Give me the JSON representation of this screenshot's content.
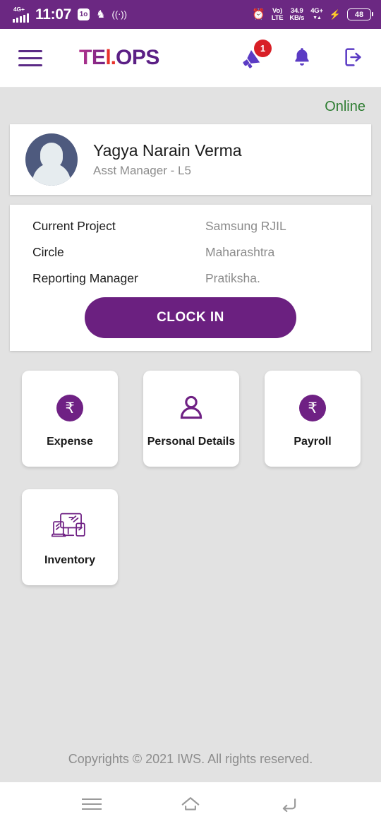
{
  "status_bar": {
    "network_tag": "4G+",
    "signal_icon": "signal-bars-icon",
    "time": "11:07",
    "data_saver_label": "1o",
    "usb_icon": "usb-icon",
    "cast_icon": "cast-icon",
    "alarm_icon": "alarm-clock-icon",
    "volte_line1": "Vo)",
    "volte_line2": "LTE",
    "speed_line1": "34.9",
    "speed_line2": "KB/s",
    "net_line1": "4G+",
    "net_line2": "▼▲",
    "charging_icon": "lightning-bolt-icon",
    "battery_level": "48"
  },
  "header": {
    "menu_icon": "hamburger-menu-icon",
    "logo_part1": "TE",
    "logo_accent": "l.",
    "logo_part2": "OPS",
    "announcement_icon": "megaphone-icon",
    "announcement_badge": "1",
    "notification_icon": "bell-icon",
    "logout_icon": "logout-icon"
  },
  "main": {
    "status_label": "Online",
    "profile": {
      "avatar": "user-avatar-placeholder",
      "name": "Yagya  Narain Verma",
      "role": "Asst Manager - L5"
    },
    "info_rows": [
      {
        "label": "Current Project",
        "value": "Samsung RJIL"
      },
      {
        "label": "Circle",
        "value": "Maharashtra"
      },
      {
        "label": "Reporting Manager",
        "value": "Pratiksha."
      }
    ],
    "clock_in_label": "CLOCK IN",
    "tiles": [
      {
        "label": "Expense",
        "icon": "rupee-coin-icon"
      },
      {
        "label": "Personal Details",
        "icon": "person-icon"
      },
      {
        "label": "Payroll",
        "icon": "rupee-coin-icon"
      },
      {
        "label": "Inventory",
        "icon": "devices-icon"
      }
    ],
    "footer_text": "Copyrights © 2021 IWS. All rights reserved."
  },
  "system_nav": {
    "recents_icon": "recents-icon",
    "home_icon": "home-icon",
    "back_icon": "back-icon"
  },
  "colors": {
    "brand_purple": "#6b2080",
    "status_bar_purple": "#6b2882",
    "badge_red": "#d81f26",
    "online_green": "#2e7d32",
    "page_background": "#e2e2e2"
  }
}
